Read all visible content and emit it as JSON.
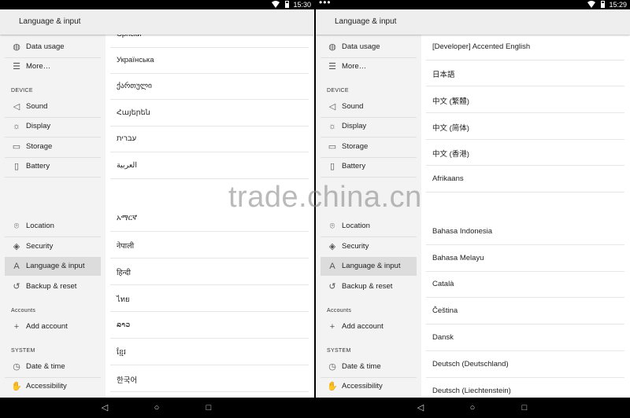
{
  "screens": [
    {
      "status": {
        "time": "15:30",
        "dots": ""
      },
      "title": "Language & input",
      "sidebar": {
        "items": [
          {
            "label": "Data usage",
            "icon": "data-usage-icon",
            "glyph": "◍"
          },
          {
            "label": "More…",
            "icon": "more-icon",
            "glyph": "☰"
          },
          {
            "label": "Sound",
            "icon": "sound-icon",
            "glyph": "◁"
          },
          {
            "label": "Display",
            "icon": "display-icon",
            "glyph": "☼"
          },
          {
            "label": "Storage",
            "icon": "storage-icon",
            "glyph": "▭"
          },
          {
            "label": "Battery",
            "icon": "battery-icon",
            "glyph": "▯"
          },
          {
            "label": "Location",
            "icon": "location-icon",
            "glyph": "⌾"
          },
          {
            "label": "Security",
            "icon": "security-icon",
            "glyph": "◈"
          },
          {
            "label": "Language & input",
            "icon": "language-icon",
            "glyph": "A"
          },
          {
            "label": "Backup & reset",
            "icon": "backup-icon",
            "glyph": "↺"
          },
          {
            "label": "Add account",
            "icon": "add-account-icon",
            "glyph": "+"
          },
          {
            "label": "Date & time",
            "icon": "clock-icon",
            "glyph": "◷"
          },
          {
            "label": "Accessibility",
            "icon": "accessibility-icon",
            "glyph": "✋"
          }
        ],
        "sections": {
          "device": "DEVICE",
          "accounts": "Accounts",
          "system": "SYSTEM"
        }
      },
      "languages": [
        "Српски",
        "Українська",
        "ქართული",
        "Հայերեն",
        "עברית",
        "العربية",
        "",
        "አማርኛ",
        "नेपाली",
        "हिन्दी",
        "ไทย",
        "ລາວ",
        "ខ្មែរ",
        "한국어"
      ]
    },
    {
      "status": {
        "time": "15:29",
        "dots": "•••"
      },
      "title": "Language & input",
      "sidebar": {
        "items": [
          {
            "label": "Data usage",
            "icon": "data-usage-icon",
            "glyph": "◍"
          },
          {
            "label": "More…",
            "icon": "more-icon",
            "glyph": "☰"
          },
          {
            "label": "Sound",
            "icon": "sound-icon",
            "glyph": "◁"
          },
          {
            "label": "Display",
            "icon": "display-icon",
            "glyph": "☼"
          },
          {
            "label": "Storage",
            "icon": "storage-icon",
            "glyph": "▭"
          },
          {
            "label": "Battery",
            "icon": "battery-icon",
            "glyph": "▯"
          },
          {
            "label": "Location",
            "icon": "location-icon",
            "glyph": "⌾"
          },
          {
            "label": "Security",
            "icon": "security-icon",
            "glyph": "◈"
          },
          {
            "label": "Language & input",
            "icon": "language-icon",
            "glyph": "A"
          },
          {
            "label": "Backup & reset",
            "icon": "backup-icon",
            "glyph": "↺"
          },
          {
            "label": "Add account",
            "icon": "add-account-icon",
            "glyph": "+"
          },
          {
            "label": "Date & time",
            "icon": "clock-icon",
            "glyph": "◷"
          },
          {
            "label": "Accessibility",
            "icon": "accessibility-icon",
            "glyph": "✋"
          }
        ],
        "sections": {
          "device": "DEVICE",
          "accounts": "Accounts",
          "system": "SYSTEM"
        }
      },
      "languages": [
        "[Developer] Accented English",
        "日本語",
        "中文 (繁體)",
        "中文 (简体)",
        "中文 (香港)",
        "Afrikaans",
        "",
        "Bahasa Indonesia",
        "Bahasa Melayu",
        "Català",
        "Čeština",
        "Dansk",
        "Deutsch (Deutschland)",
        "Deutsch (Liechtenstein)"
      ]
    }
  ],
  "nav": {
    "back": "◁",
    "home": "○",
    "recents": "□"
  },
  "watermark": "trade.china.cn",
  "colors": {
    "active_item": "#dcdcdc",
    "sidebar_bg": "#f3f3f3",
    "appbar_bg": "#eeeeee"
  }
}
